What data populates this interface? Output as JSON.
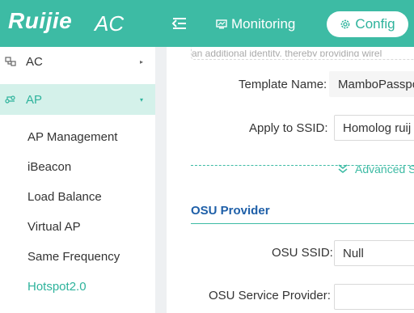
{
  "header": {
    "logo_text": "Ruijie",
    "product": "AC",
    "nav_monitoring": "Monitoring",
    "nav_config": "Config"
  },
  "sidebar": {
    "items": [
      {
        "label": "AC",
        "icon": "ac-icon",
        "arrow": "▸"
      },
      {
        "label": "AP",
        "icon": "ap-icon",
        "arrow": "▾"
      }
    ],
    "sub_items": [
      {
        "label": "AP Management"
      },
      {
        "label": "iBeacon"
      },
      {
        "label": "Load Balance"
      },
      {
        "label": "Virtual AP"
      },
      {
        "label": "Same Frequency"
      },
      {
        "label": "Hotspot2.0"
      }
    ]
  },
  "main": {
    "notice": "an additional identity, thereby providing wirel",
    "template_name_label": "Template Name:",
    "template_name_value": "MamboPasspo",
    "apply_ssid_label": "Apply to SSID:",
    "apply_ssid_value": "Homolog ruij",
    "advanced": "Advanced S",
    "osu_section_title": "OSU Provider",
    "osu_ssid_label": "OSU SSID:",
    "osu_ssid_value": "Null",
    "osu_provider_label": "OSU Service Provider:",
    "osu_provider_value": ""
  },
  "colors": {
    "brand": "#3dbba4",
    "active_bg": "#d4f1ea",
    "section_title": "#1e5fa8"
  }
}
